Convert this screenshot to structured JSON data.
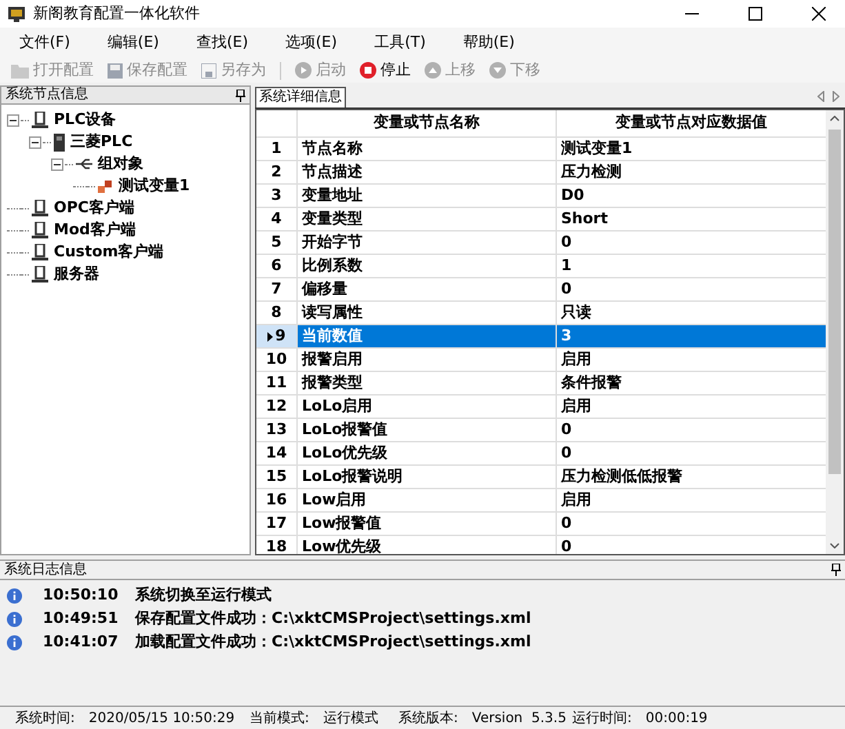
{
  "window": {
    "title": "新阁教育配置一体化软件"
  },
  "menu": [
    "文件(F)",
    "编辑(E)",
    "查找(E)",
    "选项(E)",
    "工具(T)",
    "帮助(E)"
  ],
  "toolbar": [
    {
      "label": "打开配置",
      "kind": "folder",
      "disabled": true
    },
    {
      "label": "保存配置",
      "kind": "save",
      "disabled": true
    },
    {
      "label": "另存为",
      "kind": "saveas",
      "disabled": true
    },
    {
      "label": "启动",
      "kind": "play",
      "disabled": true
    },
    {
      "label": "停止",
      "kind": "stop",
      "disabled": false
    },
    {
      "label": "上移",
      "kind": "up",
      "disabled": true
    },
    {
      "label": "下移",
      "kind": "down",
      "disabled": true
    }
  ],
  "node_panel": {
    "title": "系统节点信息",
    "tree": [
      {
        "label": "PLC设备",
        "kind": "device",
        "expanded": true,
        "children": [
          {
            "label": "三菱PLC",
            "kind": "plc",
            "expanded": true,
            "children": [
              {
                "label": "组对象",
                "kind": "group",
                "expanded": true,
                "children": [
                  {
                    "label": "测试变量1",
                    "kind": "variable"
                  }
                ]
              }
            ]
          }
        ]
      },
      {
        "label": "OPC客户端",
        "kind": "device"
      },
      {
        "label": "Mod客户端",
        "kind": "device"
      },
      {
        "label": "Custom客户端",
        "kind": "device"
      },
      {
        "label": "服务器",
        "kind": "device"
      }
    ]
  },
  "detail_panel": {
    "tab": "系统详细信息",
    "table": {
      "columns": [
        "变量或节点名称",
        "变量或节点对应数据值"
      ],
      "rows": [
        {
          "index": "1",
          "name": "节点名称",
          "value": "测试变量1",
          "selected": false
        },
        {
          "index": "2",
          "name": "节点描述",
          "value": "压力检测",
          "selected": false
        },
        {
          "index": "3",
          "name": "变量地址",
          "value": "D0",
          "selected": false
        },
        {
          "index": "4",
          "name": "变量类型",
          "value": "Short",
          "selected": false
        },
        {
          "index": "5",
          "name": "开始字节",
          "value": "0",
          "selected": false
        },
        {
          "index": "6",
          "name": "比例系数",
          "value": "1",
          "selected": false
        },
        {
          "index": "7",
          "name": "偏移量",
          "value": "0",
          "selected": false
        },
        {
          "index": "8",
          "name": "读写属性",
          "value": "只读",
          "selected": false
        },
        {
          "index": "9",
          "name": "当前数值",
          "value": "3",
          "selected": true
        },
        {
          "index": "10",
          "name": "报警启用",
          "value": "启用",
          "selected": false
        },
        {
          "index": "11",
          "name": "报警类型",
          "value": "条件报警",
          "selected": false
        },
        {
          "index": "12",
          "name": "LoLo启用",
          "value": "启用",
          "selected": false
        },
        {
          "index": "13",
          "name": "LoLo报警值",
          "value": "0",
          "selected": false
        },
        {
          "index": "14",
          "name": "LoLo优先级",
          "value": "0",
          "selected": false
        },
        {
          "index": "15",
          "name": "LoLo报警说明",
          "value": "压力检测低低报警",
          "selected": false
        },
        {
          "index": "16",
          "name": "Low启用",
          "value": "启用",
          "selected": false
        },
        {
          "index": "17",
          "name": "Low报警值",
          "value": "0",
          "selected": false
        },
        {
          "index": "18",
          "name": "Low优先级",
          "value": "0",
          "selected": false
        }
      ]
    }
  },
  "log_panel": {
    "title": "系统日志信息",
    "entries": [
      {
        "time": "10:50:10",
        "message": "系统切换至运行模式"
      },
      {
        "time": "10:49:51",
        "message": "保存配置文件成功：C:\\xktCMSProject\\settings.xml"
      },
      {
        "time": "10:41:07",
        "message": "加载配置文件成功：C:\\xktCMSProject\\settings.xml"
      }
    ]
  },
  "status_bar": [
    {
      "label": "系统时间:",
      "value": "2020/05/15 10:50:29"
    },
    {
      "label": "当前模式:",
      "value": "运行模式"
    },
    {
      "label": "系统版本:",
      "value": "Version  5.3.5"
    },
    {
      "label": "运行时间:",
      "value": "00:00:19"
    }
  ]
}
